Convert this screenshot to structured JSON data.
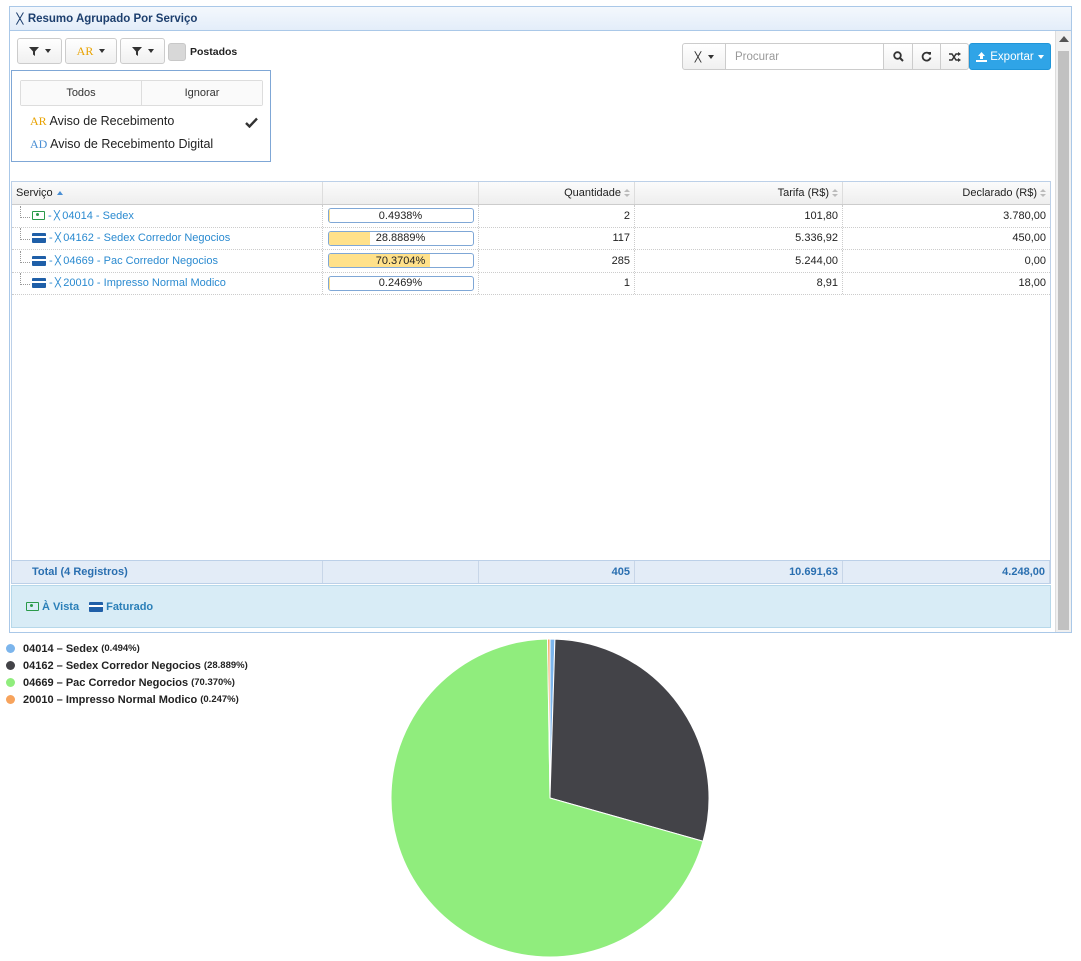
{
  "panel": {
    "title": "Resumo Agrupado Por Serviço"
  },
  "toolbar": {
    "filter_ar_label": "AR",
    "postados_label": "Postados",
    "search_placeholder": "Procurar",
    "export_label": "Exportar"
  },
  "dropdown": {
    "todos_label": "Todos",
    "ignorar_label": "Ignorar",
    "items": [
      {
        "prefix": "AR",
        "label": "Aviso de Recebimento",
        "checked": true
      },
      {
        "prefix": "AD",
        "label": "Aviso de Recebimento Digital",
        "checked": false
      }
    ]
  },
  "grid": {
    "headers": {
      "servico": "Serviço",
      "quantidade": "Quantidade",
      "tarifa": "Tarifa (R$)",
      "declarado": "Declarado (R$)"
    },
    "rows": [
      {
        "icon": "cash",
        "servico": "04014 - Sedex",
        "percent": 0.4938,
        "percent_label": "0.4938%",
        "quantidade": "2",
        "tarifa": "101,80",
        "declarado": "3.780,00"
      },
      {
        "icon": "card",
        "servico": "04162 - Sedex Corredor Negocios",
        "percent": 28.8889,
        "percent_label": "28.8889%",
        "quantidade": "117",
        "tarifa": "5.336,92",
        "declarado": "450,00"
      },
      {
        "icon": "card",
        "servico": "04669 - Pac Corredor Negocios",
        "percent": 70.3704,
        "percent_label": "70.3704%",
        "quantidade": "285",
        "tarifa": "5.244,00",
        "declarado": "0,00"
      },
      {
        "icon": "card",
        "servico": "20010 - Impresso Normal Modico",
        "percent": 0.2469,
        "percent_label": "0.2469%",
        "quantidade": "1",
        "tarifa": "8,91",
        "declarado": "18,00"
      }
    ],
    "footer": {
      "label": "Total (4 Registros)",
      "quantidade": "405",
      "tarifa": "10.691,63",
      "declarado": "4.248,00"
    }
  },
  "payment_legend": {
    "vista_label": "À Vista",
    "faturado_label": "Faturado"
  },
  "chart_data": {
    "type": "pie",
    "legend_position": "top-left",
    "slices": [
      {
        "label": "04014 – Sedex",
        "pct_label": "(0.494%)",
        "value": 0.494,
        "color": "#7cb5ec"
      },
      {
        "label": "04162 – Sedex Corredor Negocios",
        "pct_label": "(28.889%)",
        "value": 28.889,
        "color": "#434348"
      },
      {
        "label": "04669 – Pac Corredor Negocios",
        "pct_label": "(70.370%)",
        "value": 70.37,
        "color": "#90ed7d"
      },
      {
        "label": "20010 – Impresso Normal Modico",
        "pct_label": "(0.247%)",
        "value": 0.247,
        "color": "#f7a35c"
      }
    ]
  },
  "colors": {
    "accent": "#2fa4e7",
    "link": "#2a8ad0",
    "bar_fill": "#ffe18a"
  }
}
